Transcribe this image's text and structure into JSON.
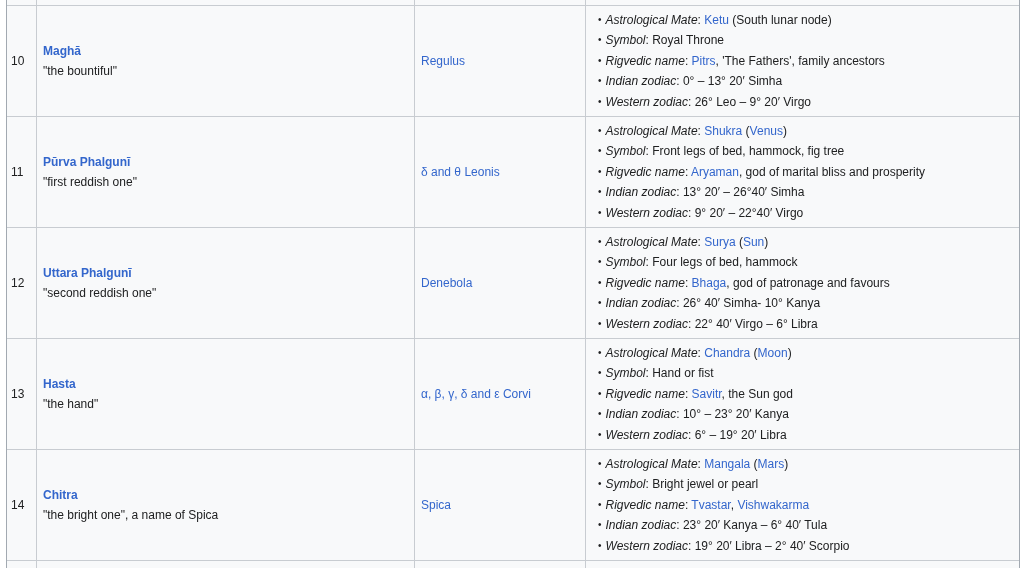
{
  "rows": [
    {
      "number": "10",
      "name": "Maghā",
      "meaning": "\"the bountiful\"",
      "stars": "Regulus",
      "details": [
        {
          "bullet": "•",
          "parts": [
            {
              "kind": "text",
              "text": "*Astrological Mate*: "
            },
            {
              "kind": "link",
              "text": "Ketu"
            },
            {
              "kind": "text",
              "text": " (South lunar node)"
            }
          ]
        },
        {
          "bullet": "•",
          "parts": [
            {
              "kind": "text",
              "text": "*Symbol*: Royal Throne"
            }
          ]
        },
        {
          "bullet": "•",
          "parts": [
            {
              "kind": "text",
              "text": "*Rigvedic name*: "
            },
            {
              "kind": "link",
              "text": "Pitrs"
            },
            {
              "kind": "text",
              "text": ", 'The Fathers', family ancestors"
            }
          ]
        },
        {
          "bullet": "•",
          "parts": [
            {
              "kind": "text",
              "text": "*Indian zodiac*: 0° – 13° 20′ Simha"
            }
          ]
        },
        {
          "bullet": "•",
          "parts": [
            {
              "kind": "text",
              "text": "*Western zodiac*: 26° Leo – 9° 20′ Virgo"
            }
          ]
        }
      ]
    },
    {
      "number": "11",
      "name": "Pūrva Phalgunī",
      "meaning": "\"first reddish one\"",
      "stars": "δ and θ Leonis",
      "details": [
        {
          "bullet": "•",
          "parts": [
            {
              "kind": "text",
              "text": "*Astrological Mate*: "
            },
            {
              "kind": "link",
              "text": "Shukra"
            },
            {
              "kind": "text",
              "text": " ("
            },
            {
              "kind": "link",
              "text": "Venus"
            },
            {
              "kind": "text",
              "text": ")"
            }
          ]
        },
        {
          "bullet": "•",
          "parts": [
            {
              "kind": "text",
              "text": "*Symbol*: Front legs of bed, hammock, fig tree"
            }
          ]
        },
        {
          "bullet": "•",
          "parts": [
            {
              "kind": "text",
              "text": "*Rigvedic name*: "
            },
            {
              "kind": "link",
              "text": "Aryaman"
            },
            {
              "kind": "text",
              "text": ", god of marital bliss and prosperity"
            }
          ]
        },
        {
          "bullet": "•",
          "parts": [
            {
              "kind": "text",
              "text": "*Indian zodiac*: 13° 20′ – 26°40′ Simha"
            }
          ]
        },
        {
          "bullet": "•",
          "parts": [
            {
              "kind": "text",
              "text": "*Western zodiac*: 9° 20′ – 22°40′ Virgo"
            }
          ]
        }
      ]
    },
    {
      "number": "12",
      "name": "Uttara Phalgunī",
      "meaning": "\"second reddish one\"",
      "stars": "Denebola",
      "details": [
        {
          "bullet": "•",
          "parts": [
            {
              "kind": "text",
              "text": "*Astrological Mate*: "
            },
            {
              "kind": "link",
              "text": "Surya"
            },
            {
              "kind": "text",
              "text": " ("
            },
            {
              "kind": "link",
              "text": "Sun"
            },
            {
              "kind": "text",
              "text": ")"
            }
          ]
        },
        {
          "bullet": "•",
          "parts": [
            {
              "kind": "text",
              "text": "*Symbol*: Four legs of bed, hammock"
            }
          ]
        },
        {
          "bullet": "•",
          "parts": [
            {
              "kind": "text",
              "text": "*Rigvedic name*: "
            },
            {
              "kind": "link",
              "text": "Bhaga"
            },
            {
              "kind": "text",
              "text": ", god of patronage and favours"
            }
          ]
        },
        {
          "bullet": "•",
          "parts": [
            {
              "kind": "text",
              "text": "*Indian zodiac*: 26° 40′ Simha- 10° Kanya"
            }
          ]
        },
        {
          "bullet": "•",
          "parts": [
            {
              "kind": "text",
              "text": "*Western zodiac*: 22° 40′ Virgo – 6° Libra"
            }
          ]
        }
      ]
    },
    {
      "number": "13",
      "name": "Hasta",
      "meaning": "\"the hand\"",
      "stars": "α, β, γ, δ and ε Corvi",
      "details": [
        {
          "bullet": "•",
          "parts": [
            {
              "kind": "text",
              "text": "*Astrological Mate*: "
            },
            {
              "kind": "link",
              "text": "Chandra"
            },
            {
              "kind": "text",
              "text": " ("
            },
            {
              "kind": "link",
              "text": "Moon"
            },
            {
              "kind": "text",
              "text": ")"
            }
          ]
        },
        {
          "bullet": "•",
          "parts": [
            {
              "kind": "text",
              "text": "*Symbol*: Hand or fist"
            }
          ]
        },
        {
          "bullet": "•",
          "parts": [
            {
              "kind": "text",
              "text": "*Rigvedic name*: "
            },
            {
              "kind": "link",
              "text": "Savitr"
            },
            {
              "kind": "text",
              "text": ", the Sun god"
            }
          ]
        },
        {
          "bullet": "•",
          "parts": [
            {
              "kind": "text",
              "text": "*Indian zodiac*: 10° – 23° 20′ Kanya"
            }
          ]
        },
        {
          "bullet": "•",
          "parts": [
            {
              "kind": "text",
              "text": "*Western zodiac*: 6° – 19° 20′ Libra"
            }
          ]
        }
      ]
    },
    {
      "number": "14",
      "name": "Chitra",
      "meaning": "\"the bright one\", a name of Spica",
      "stars": "Spica",
      "details": [
        {
          "bullet": "•",
          "parts": [
            {
              "kind": "text",
              "text": "*Astrological Mate*: "
            },
            {
              "kind": "link",
              "text": "Mangala"
            },
            {
              "kind": "text",
              "text": " ("
            },
            {
              "kind": "link",
              "text": "Mars"
            },
            {
              "kind": "text",
              "text": ")"
            }
          ]
        },
        {
          "bullet": "•",
          "parts": [
            {
              "kind": "text",
              "text": "*Symbol*: Bright jewel or pearl"
            }
          ]
        },
        {
          "bullet": "•",
          "parts": [
            {
              "kind": "text",
              "text": "*Rigvedic name*: "
            },
            {
              "kind": "link",
              "text": "Tvastar"
            },
            {
              "kind": "text",
              "text": ", "
            },
            {
              "kind": "link",
              "text": "Vishwakarma"
            }
          ]
        },
        {
          "bullet": "•",
          "parts": [
            {
              "kind": "text",
              "text": "*Indian zodiac*: 23° 20′ Kanya – 6° 40′ Tula"
            }
          ]
        },
        {
          "bullet": "•",
          "parts": [
            {
              "kind": "text",
              "text": "*Western zodiac*: 19° 20′ Libra – 2° 40′ Scorpio"
            }
          ]
        }
      ]
    }
  ]
}
